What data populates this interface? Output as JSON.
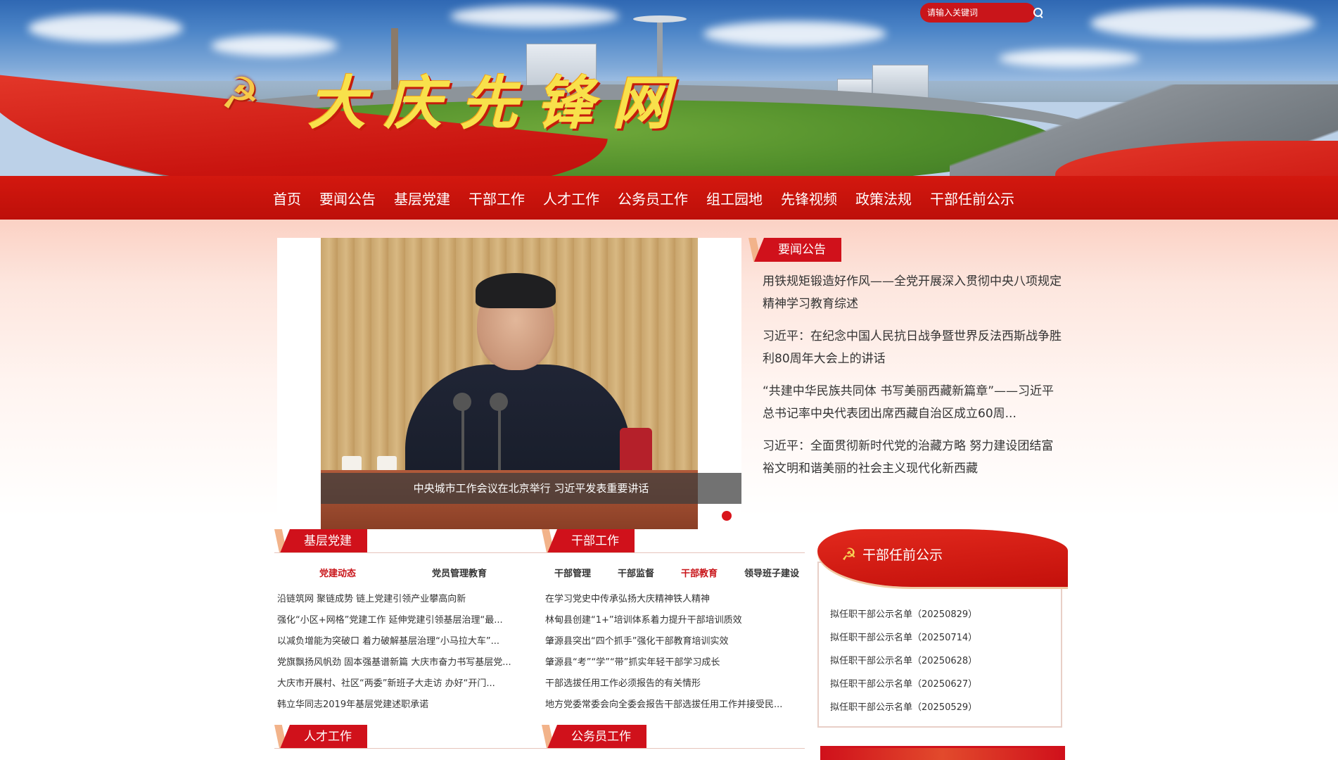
{
  "header": {
    "site_title": "大庆先锋网",
    "search_placeholder": "请输入关键词"
  },
  "nav": {
    "items": [
      "首页",
      "要闻公告",
      "基层党建",
      "干部工作",
      "人才工作",
      "公务员工作",
      "组工园地",
      "先锋视频",
      "政策法规",
      "干部任前公示"
    ]
  },
  "carousel": {
    "caption": "中央城市工作会议在北京举行 习近平发表重要讲话",
    "slide_count": 2,
    "active_index": 1
  },
  "news": {
    "title": "要闻公告",
    "items": [
      "用铁规矩锻造好作风——全党开展深入贯彻中央八项规定精神学习教育综述",
      "习近平：在纪念中国人民抗日战争暨世界反法西斯战争胜利80周年大会上的讲话",
      "“共建中华民族共同体 书写美丽西藏新篇章”——习近平总书记率中央代表团出席西藏自治区成立60周...",
      "习近平：全面贯彻新时代党的治藏方略 努力建设团结富裕文明和谐美丽的社会主义现代化新西藏"
    ]
  },
  "jiceng": {
    "title": "基层党建",
    "tabs": [
      "党建动态",
      "党员管理教育"
    ],
    "active_tab": 0,
    "items": [
      "沿链筑网 聚链成势 链上党建引领产业攀高向新",
      "强化“小区+网格”党建工作 延伸党建引领基层治理“最...",
      "以减负增能为突破口 着力破解基层治理“小马拉大车”...",
      "党旗飘扬风帆劲 固本强基谱新篇 大庆市奋力书写基层党...",
      "大庆市开展村、社区“两委”新班子大走访 办好“开门...",
      "韩立华同志2019年基层党建述职承诺"
    ]
  },
  "ganbu": {
    "title": "干部工作",
    "tabs": [
      "干部管理",
      "干部监督",
      "干部教育",
      "领导班子建设"
    ],
    "active_tab": 2,
    "items": [
      "在学习党史中传承弘扬大庆精神铁人精神",
      "林甸县创建“1+”培训体系着力提升干部培训质效",
      "肇源县突出“四个抓手”强化干部教育培训实效",
      "肇源县“考”“学”“带”抓实年轻干部学习成长",
      "干部选拔任用工作必须报告的有关情形",
      "地方党委常委会向全委会报告干部选拔任用工作并接受民..."
    ]
  },
  "rencai": {
    "title": "人才工作"
  },
  "gongwuyuan": {
    "title": "公务员工作"
  },
  "sidebar": {
    "title": "干部任前公示",
    "items": [
      "拟任职干部公示名单（20250829）",
      "拟任职干部公示名单（20250714）",
      "拟任职干部公示名单（20250628）",
      "拟任职干部公示名单（20250627）",
      "拟任职干部公示名单（20250529）"
    ]
  },
  "colors": {
    "brand_red": "#d0111b",
    "nav_red": "#c9140f",
    "accent_gold": "#f8e14b"
  }
}
